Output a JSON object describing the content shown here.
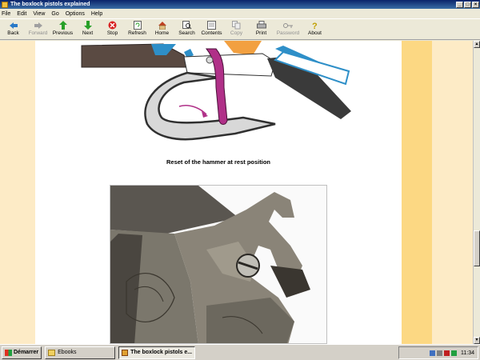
{
  "window": {
    "title": "The boxlock pistols explained"
  },
  "menu": [
    "File",
    "Edit",
    "View",
    "Go",
    "Options",
    "Help"
  ],
  "toolbar": [
    {
      "label": "Back",
      "icon": "back-arrow-icon",
      "enabled": true
    },
    {
      "label": "Forward",
      "icon": "forward-arrow-icon",
      "enabled": false
    },
    {
      "label": "Previous",
      "icon": "up-arrow-icon",
      "enabled": true
    },
    {
      "label": "Next",
      "icon": "down-arrow-icon",
      "enabled": true
    },
    {
      "label": "Stop",
      "icon": "stop-icon",
      "enabled": true
    },
    {
      "label": "Refresh",
      "icon": "refresh-icon",
      "enabled": true
    },
    {
      "label": "Home",
      "icon": "home-icon",
      "enabled": true
    },
    {
      "label": "Search",
      "icon": "search-icon",
      "enabled": true
    },
    {
      "label": "Contents",
      "icon": "contents-icon",
      "enabled": true
    },
    {
      "label": "Copy",
      "icon": "copy-icon",
      "enabled": false
    },
    {
      "label": "Print",
      "icon": "print-icon",
      "enabled": true
    },
    {
      "label": "Password",
      "icon": "key-icon",
      "enabled": false
    },
    {
      "label": "About",
      "icon": "question-icon",
      "enabled": true
    }
  ],
  "page": {
    "caption": "Reset of the hammer at rest position"
  },
  "taskbar": {
    "start_label": "Démarrer",
    "tasks": [
      {
        "label": "Ebooks",
        "active": false
      },
      {
        "label": "The boxlock pistols e...",
        "active": true
      }
    ],
    "clock": "11:34"
  },
  "colors": {
    "page_bg": "#ffffff",
    "side_stripe": "#fcd883",
    "margin": "#fdebc6"
  }
}
